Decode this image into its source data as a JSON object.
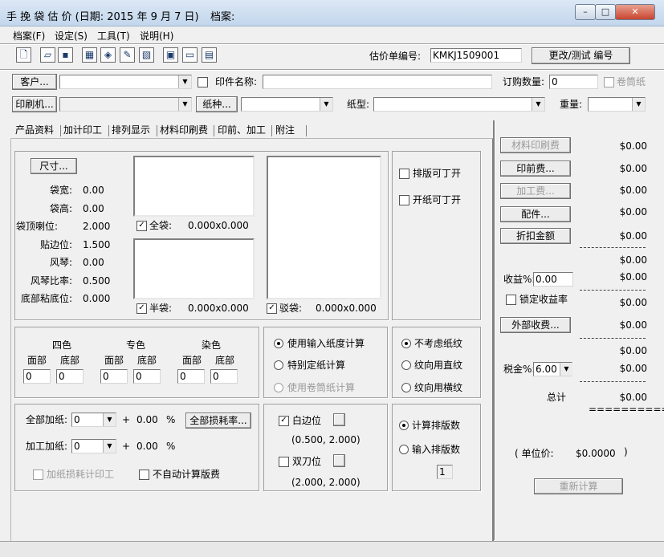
{
  "window": {
    "title": "手 挽 袋 估 价  (日期: 2015 年  9 月  7 日)",
    "file_label": "档案:"
  },
  "menu": [
    "档案(F)",
    "设定(S)",
    "工具(T)",
    "说明(H)"
  ],
  "header": {
    "quote_no_label": "估价单编号:",
    "quote_no_value": "KMKJ1509001",
    "change_button": "更改/测试 编号"
  },
  "row1": {
    "customer_button": "客户...",
    "part_name_label": "印件名称:",
    "order_qty_label": "订购数量:",
    "order_qty_value": "0",
    "roll_paper_label": "卷筒纸"
  },
  "row2": {
    "printer_button": "印刷机...",
    "paper_kind_button": "纸种...",
    "paper_type_label": "纸型:",
    "weight_label": "重量:"
  },
  "tabs": [
    "产品资料",
    "加计印工",
    "排列显示",
    "材料印刷费",
    "印前、加工",
    "附注"
  ],
  "product": {
    "size_button": "尺寸...",
    "fields": [
      {
        "label": "袋宽:",
        "value": "0.00"
      },
      {
        "label": "袋高:",
        "value": "0.00"
      },
      {
        "label": "袋顶喇位:",
        "value": "2.000"
      },
      {
        "label": "贴边位:",
        "value": "1.500"
      },
      {
        "label": "风琴:",
        "value": "0.00"
      },
      {
        "label": "风琴比率:",
        "value": "0.500"
      },
      {
        "label": "底部粘底位:",
        "value": "0.000"
      }
    ],
    "full_bag_label": "全袋:",
    "full_bag_value": "0.000x0.000",
    "half_bag_label": "半袋:",
    "half_bag_value": "0.000x0.000",
    "test_bag_label": "驳袋:",
    "test_bag_value": "0.000x0.000",
    "layout_open_label": "排版可丁开",
    "paper_open_label": "开纸可丁开"
  },
  "colors": {
    "groups": [
      "四色",
      "专色",
      "染色"
    ],
    "face_label": "面部",
    "bottom_label": "底部",
    "values": [
      "0",
      "0",
      "0",
      "0",
      "0",
      "0"
    ]
  },
  "calc_mode": {
    "options": [
      "使用输入纸度计算",
      "特别定纸计算",
      "使用卷筒纸计算"
    ]
  },
  "grain": {
    "options": [
      "不考虑纸纹",
      "纹向用直纹",
      "纹向用横纹"
    ]
  },
  "addpaper": {
    "all_label": "全部加纸:",
    "all_value": "0",
    "plus": "+",
    "all_pct_value": "0.00",
    "pct": "%",
    "loss_button": "全部损耗率...",
    "process_label": "加工加纸:",
    "process_value": "0",
    "process_pct_value": "0.00",
    "loss_calc_label": "加纸损耗计印工",
    "no_auto_label": "不自动计算版费"
  },
  "margin": {
    "white_label": "白边位",
    "white_value": "(0.500, 2.000)",
    "double_label": "双刀位",
    "double_value": "(2.000, 2.000)"
  },
  "layout_count": {
    "calc_label": "计算排版数",
    "input_label": "输入排版数",
    "input_value": "1"
  },
  "costs": {
    "material_button": "材料印刷费",
    "prepress_button": "印前费...",
    "process_button": "加工费...",
    "parts_button": "配件...",
    "discount_button": "折扣金额",
    "values": [
      "$0.00",
      "$0.00",
      "$0.00",
      "$0.00",
      "$0.00"
    ],
    "subtotal1": "$0.00",
    "profit_label": "收益%:",
    "profit_value": "0.00",
    "profit_amount": "$0.00",
    "lock_label": "锁定收益率",
    "subtotal2": "$0.00",
    "external_button": "外部收费...",
    "external_value": "$0.00",
    "subtotal3": "$0.00",
    "tax_label": "税金%:",
    "tax_value": "6.00",
    "tax_amount": "$0.00",
    "total_label": "总计",
    "total_value": "$0.00",
    "double_line": "============",
    "unit_price_label": "( 单位价:",
    "unit_price_value": "$0.0000",
    "unit_price_close": ")",
    "recalc_button": "重新计算"
  }
}
